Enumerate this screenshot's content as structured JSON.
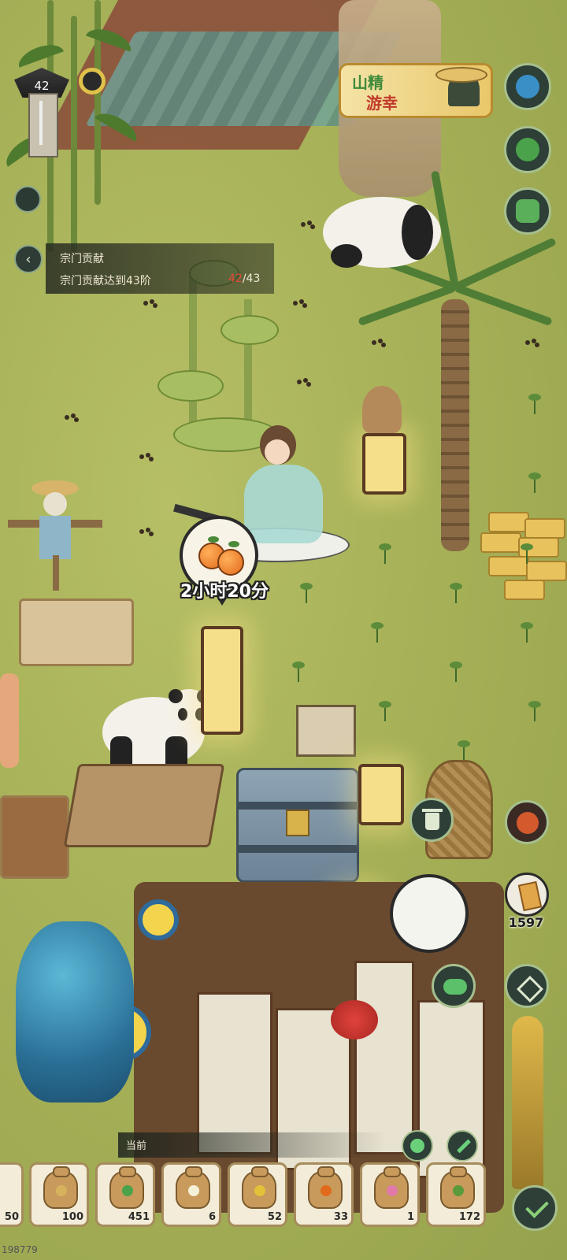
{
  "hud": {
    "level": "42",
    "event_banner": {
      "line1": "山精",
      "line2": "游幸"
    }
  },
  "quest": {
    "title": "宗门贡献",
    "desc": "宗门贡献达到43阶",
    "current": "42",
    "total": "/43"
  },
  "timer": {
    "label": "2小时20分"
  },
  "currency": {
    "value": "1597",
    "icon": "scroll-icon"
  },
  "tray": {
    "header": "当前",
    "partial_count": "50",
    "slots": [
      {
        "count": "100",
        "icon": "wheat-seed-icon",
        "color": "#d7b25c"
      },
      {
        "count": "451",
        "icon": "clover-seed-icon",
        "color": "#4aa34a"
      },
      {
        "count": "6",
        "icon": "daisy-seed-icon",
        "color": "#f4f0d8"
      },
      {
        "count": "52",
        "icon": "pear-seed-icon",
        "color": "#e3c23a"
      },
      {
        "count": "33",
        "icon": "orange-seed-icon",
        "color": "#e26a1c"
      },
      {
        "count": "1",
        "icon": "lotus-seed-icon",
        "color": "#e07aa8"
      },
      {
        "count": "172",
        "icon": "wreath-seed-icon",
        "color": "#5a9a3a"
      }
    ]
  },
  "player_id": "198779",
  "colors": {
    "hud_dark": "#2d3f37",
    "hud_border": "#a6bf8e",
    "accent_red": "#e24a3a"
  }
}
